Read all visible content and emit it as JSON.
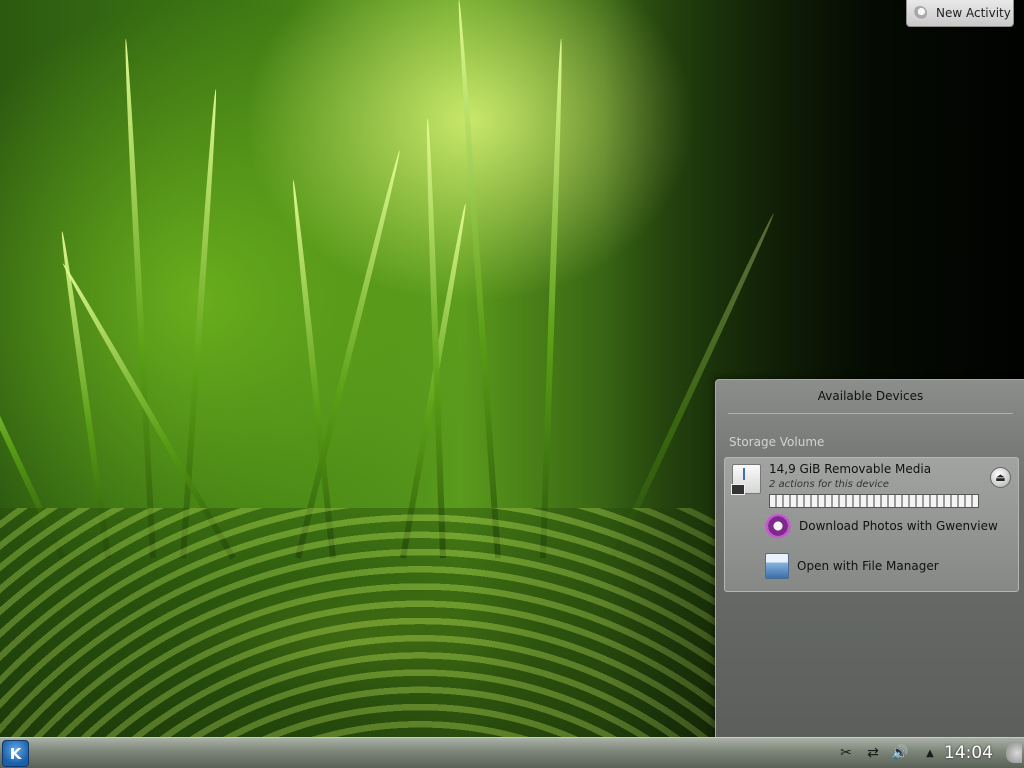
{
  "desktop": {
    "wallpaper": "green grass reflected in water"
  },
  "activity_button": {
    "label": "New Activity",
    "icon": "plasma-activity-icon"
  },
  "device_notifier": {
    "title": "Available Devices",
    "section": "Storage Volume",
    "device": {
      "name": "14,9 GiB Removable Media",
      "subtitle": "2 actions for this device",
      "icon": "usb-drive-icon",
      "usage_fraction": 1.0
    },
    "actions": [
      {
        "label": "Download Photos with Gwenview",
        "icon": "gwenview-icon"
      },
      {
        "label": "Open with File Manager",
        "icon": "file-manager-icon"
      }
    ]
  },
  "taskbar": {
    "launcher_icon": "kde-launcher-icon",
    "launcher_glyph": "K",
    "tray": [
      {
        "name": "klipper-icon",
        "glyph": "✂"
      },
      {
        "name": "network-icon",
        "glyph": "⇄"
      },
      {
        "name": "volume-icon",
        "glyph": "🔊"
      },
      {
        "name": "tray-expand-icon",
        "glyph": "▲"
      }
    ],
    "clock": "14:04"
  }
}
